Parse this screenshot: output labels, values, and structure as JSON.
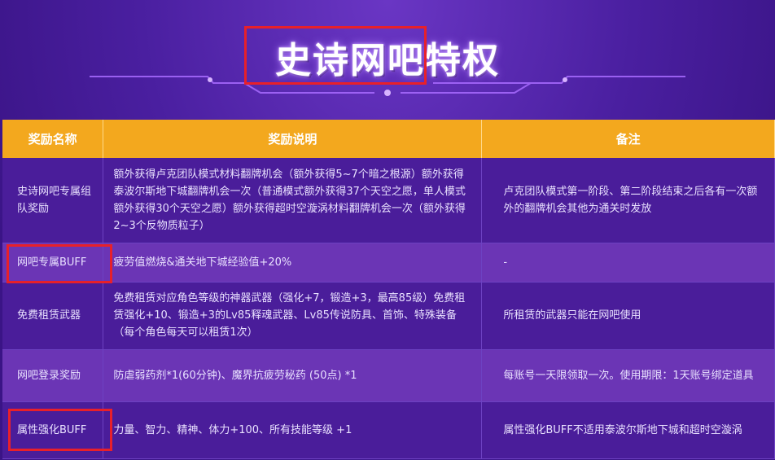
{
  "header": {
    "title": "史诗网吧特权"
  },
  "table": {
    "columns": [
      "奖励名称",
      "奖励说明",
      "备注"
    ],
    "rows": [
      {
        "name": "史诗网吧专属组队奖励",
        "desc": "额外获得卢克团队模式材料翻牌机会（额外获得5~7个暗之根源）额外获得泰波尔斯地下城翻牌机会一次（普通模式额外获得37个天空之愿，单人模式额外获得30个天空之愿）额外获得超时空漩涡材料翻牌机会一次（额外获得2~3个反物质粒子）",
        "note": "卢克团队模式第一阶段、第二阶段结束之后各有一次额外的翻牌机会其他为通关时发放"
      },
      {
        "name": "网吧专属BUFF",
        "desc": "疲劳值燃烧&通关地下城经验值+20%",
        "note": "-"
      },
      {
        "name": "免费租赁武器",
        "desc": "免费租赁对应角色等级的神器武器（强化+7，锻造+3，最高85级）免费租赁强化+10、锻造+3的Lv85释魂武器、Lv85传说防具、首饰、特殊装备（每个角色每天可以租赁1次）",
        "note": "所租赁的武器只能在网吧使用"
      },
      {
        "name": "网吧登录奖励",
        "desc": "防虐弱药剂*1(60分钟)、魔界抗疲劳秘药 (50点) *1",
        "note": "每账号一天限领取一次。使用期限：1天账号绑定道具"
      },
      {
        "name": "属性强化BUFF",
        "desc": "力量、智力、精神、体力+100、所有技能等级 +1",
        "note": "属性强化BUFF不适用泰波尔斯地下城和超时空漩涡"
      }
    ]
  },
  "colors": {
    "header_bg": "#f3a81e",
    "row_dark": "#4a1d9a",
    "row_light": "#6b35b5",
    "highlight_box": "#e8202a"
  }
}
